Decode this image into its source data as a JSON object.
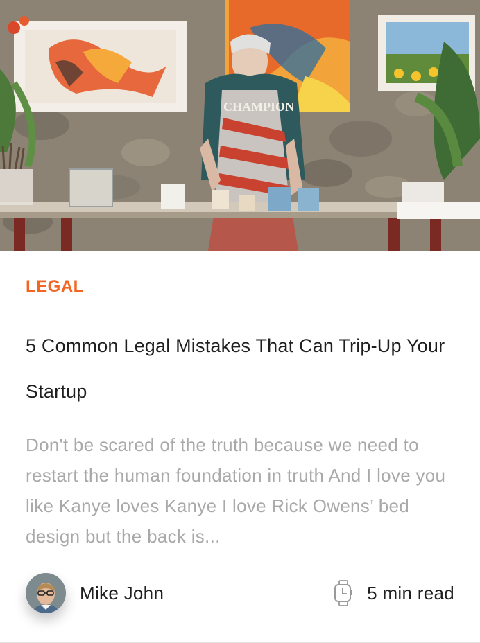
{
  "post": {
    "category": "LEGAL",
    "title": "5 Common Legal Mistakes That Can Trip-Up Your Startup",
    "excerpt": "Don't be scared of the truth because we need to restart the human foundation in truth And I love you like Kanye loves Kanye I love Rick Owens’ bed design but the back is...",
    "author_name": "Mike John",
    "read_time": "5 min read"
  },
  "hero": {
    "apron_text": "CHAMPION"
  },
  "icons": {
    "read_time_icon": "watch-icon",
    "author_avatar": "avatar"
  },
  "colors": {
    "accent": "#f26522",
    "title": "#1f1f1f",
    "excerpt": "#a9a9a9",
    "background": "#ffffff"
  }
}
